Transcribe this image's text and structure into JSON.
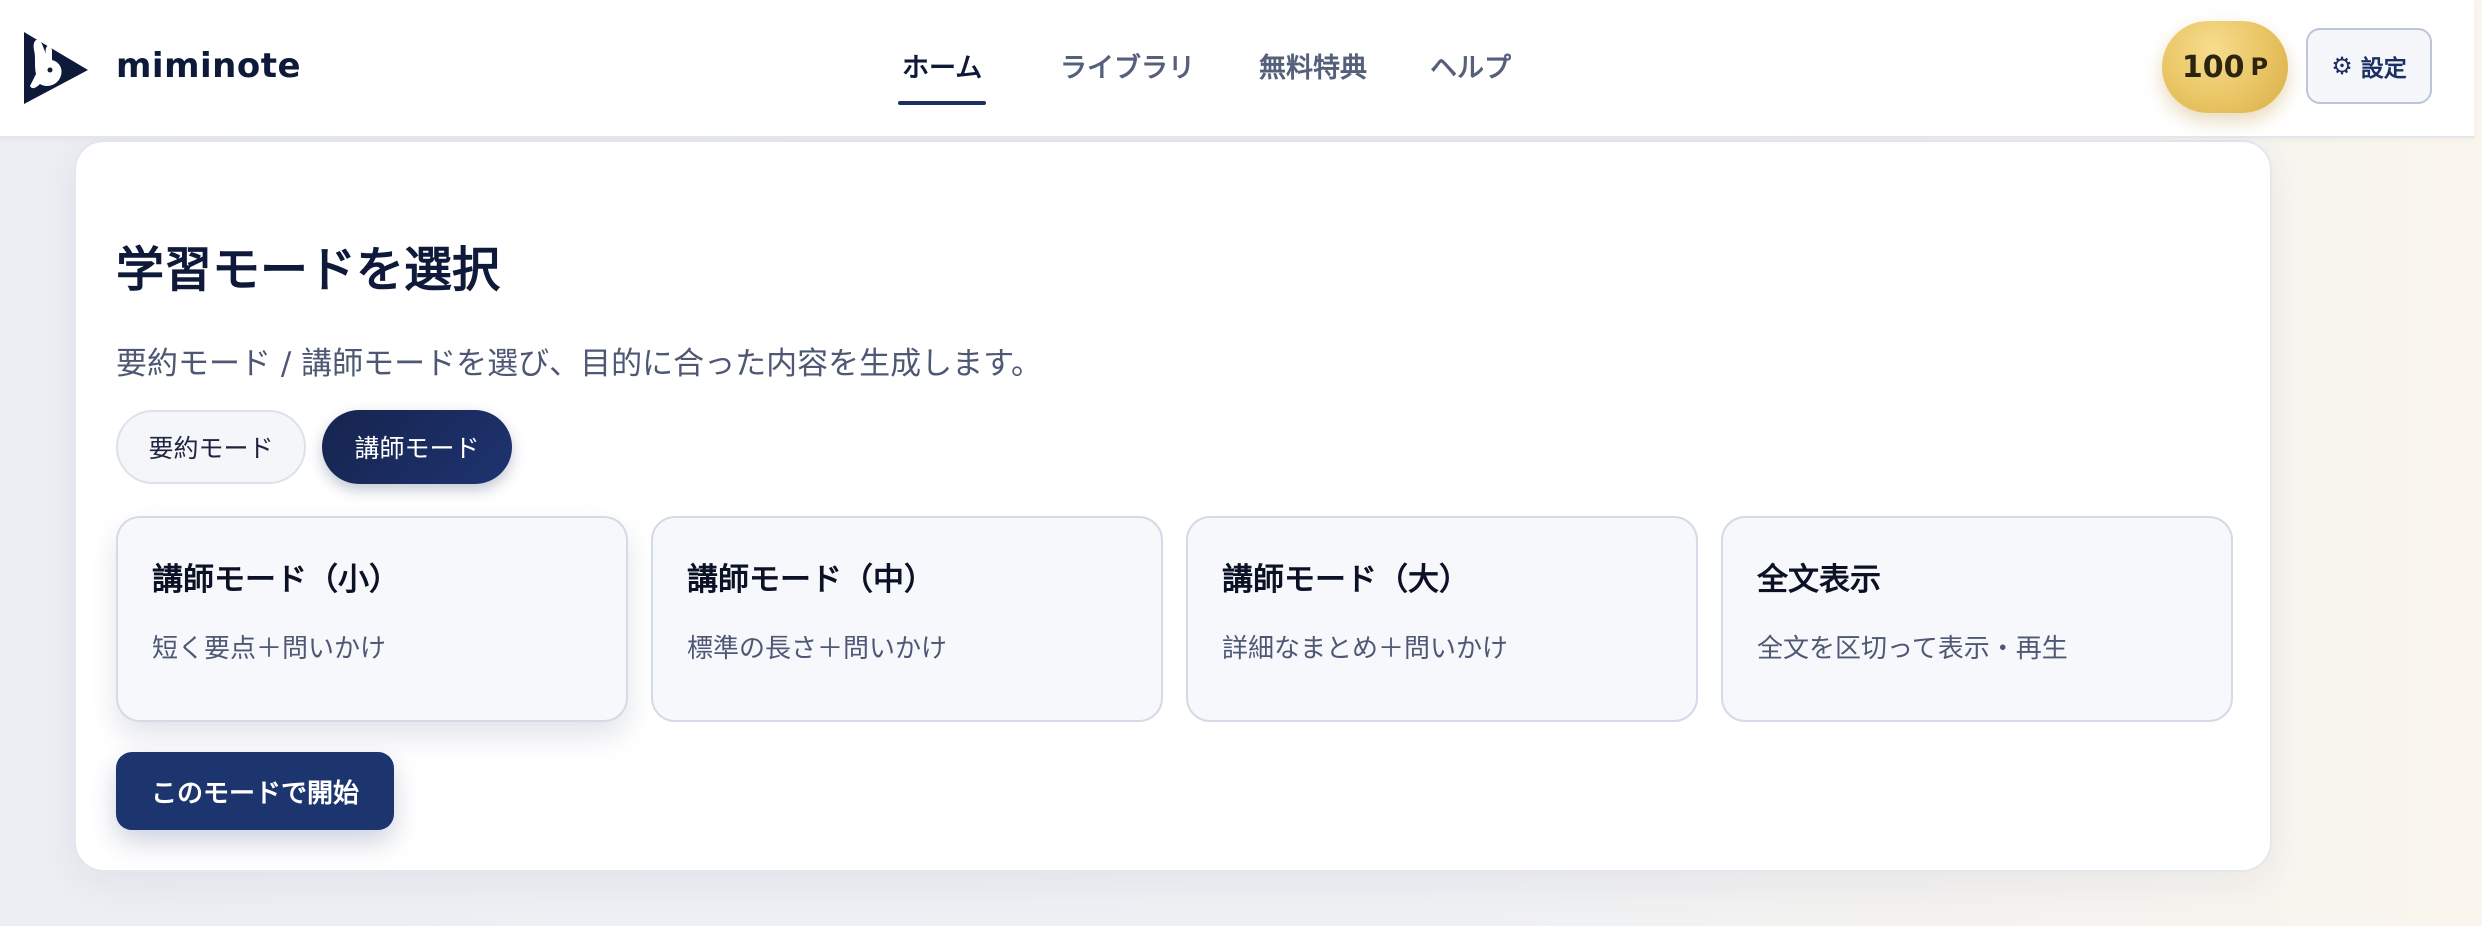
{
  "header": {
    "brand": "miminote",
    "nav": [
      {
        "label": "ホーム",
        "active": true
      },
      {
        "label": "ライブラリ",
        "active": false
      },
      {
        "label": "無料特典",
        "active": false
      },
      {
        "label": "ヘルプ",
        "active": false
      }
    ],
    "points": {
      "value": "100",
      "unit": "P"
    },
    "settings": {
      "icon": "gear-icon",
      "glyph": "⚙",
      "label": "設定"
    }
  },
  "main": {
    "title": "学習モードを選択",
    "subtitle": "要約モード / 講師モードを選び、目的に合った内容を生成します。",
    "mode_toggle": [
      {
        "label": "要約モード",
        "selected": false
      },
      {
        "label": "講師モード",
        "selected": true
      }
    ],
    "options": [
      {
        "title": "講師モード（小）",
        "description": "短く要点＋問いかけ",
        "selected": true
      },
      {
        "title": "講師モード（中）",
        "description": "標準の長さ＋問いかけ",
        "selected": false
      },
      {
        "title": "講師モード（大）",
        "description": "詳細なまとめ＋問いかけ",
        "selected": false
      },
      {
        "title": "全文表示",
        "description": "全文を区切って表示・再生",
        "selected": false
      }
    ],
    "start_button": "このモードで開始"
  },
  "colors": {
    "accent": "#1c356e",
    "text_primary": "#0f1a3a",
    "text_secondary": "#4e5874",
    "points_gold": "#e9c463"
  }
}
